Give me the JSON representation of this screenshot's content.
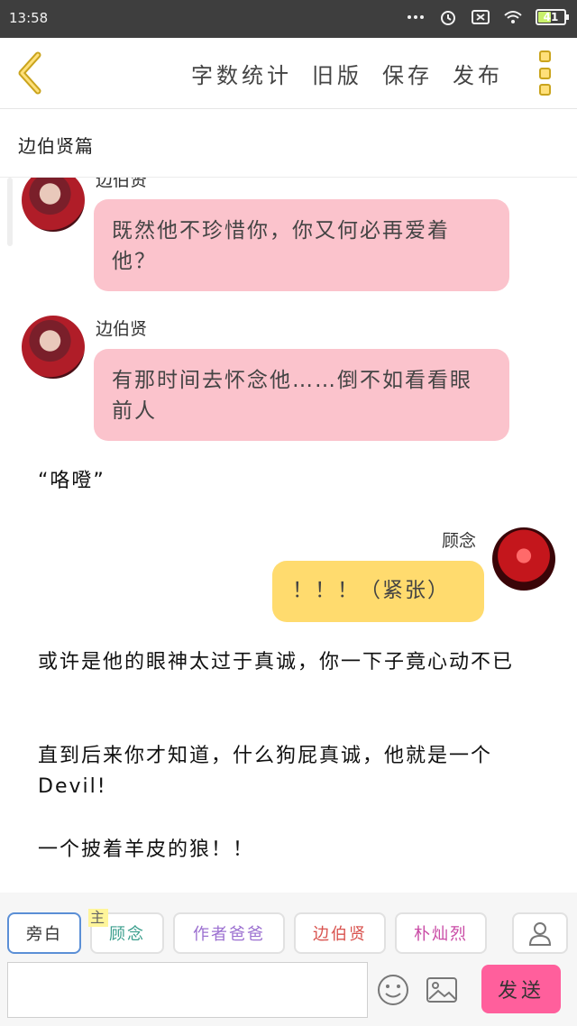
{
  "status": {
    "time": "13:58",
    "battery": "41"
  },
  "toolbar": {
    "actions": [
      "字数统计",
      "旧版",
      "保存",
      "发布"
    ]
  },
  "document": {
    "title": "边伯贤篇"
  },
  "chat": {
    "messages": [
      {
        "sender": "边伯贤",
        "text": "既然他不珍惜你，你又何必再爱着他？"
      },
      {
        "sender": "边伯贤",
        "text": "有那时间去怀念他……倒不如看看眼前人"
      },
      {
        "narration": "“咯噔”"
      },
      {
        "sender": "顾念",
        "text": "！！！（紧张）"
      },
      {
        "narration": "或许是他的眼神太过于真诚，你一下子竟心动不已"
      },
      {
        "narration": "直到后来你才知道，什么狗屁真诚，他就是一个Devil!"
      },
      {
        "narration": "一个披着羊皮的狼！！"
      }
    ]
  },
  "composer": {
    "roles": [
      {
        "label": "旁白",
        "color": "#333333",
        "selected": true
      },
      {
        "label": "顾念",
        "color": "#3a9e8c",
        "badge": "主"
      },
      {
        "label": "作者爸爸",
        "color": "#9b6fd0"
      },
      {
        "label": "边伯贤",
        "color": "#d9534f"
      },
      {
        "label": "朴灿烈",
        "color": "#c94aa5"
      }
    ],
    "input_placeholder": "",
    "send_label": "发送"
  },
  "colors": {
    "accent_pink": "#ff5f9c",
    "bubble_pink": "#fbc3cc",
    "bubble_yellow": "#ffdb6e",
    "menu_gold": "#caa41d"
  },
  "icons": [
    "back-chevron-icon",
    "more-icon",
    "profile-icon",
    "emoji-icon",
    "image-icon",
    "wifi-icon",
    "alarm-icon",
    "sim-icon",
    "signal-dots-icon"
  ]
}
